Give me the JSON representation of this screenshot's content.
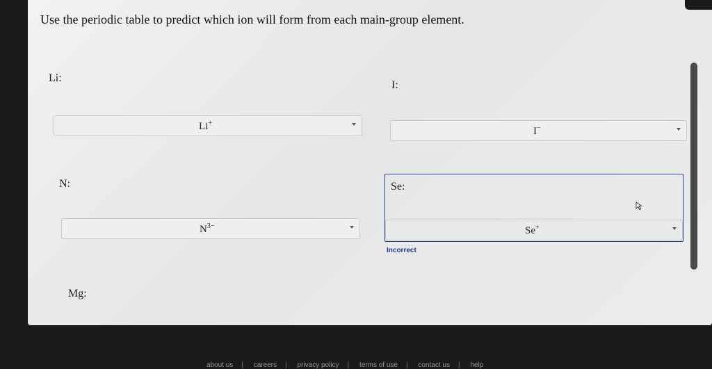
{
  "question": "Use the periodic table to predict which ion will form from each main-group element.",
  "items": [
    {
      "label": "Li:",
      "value_base": "Li",
      "value_charge": "+"
    },
    {
      "label": "I:",
      "value_base": "I",
      "value_charge": "−"
    },
    {
      "label": "N:",
      "value_base": "N",
      "value_charge": "3−"
    },
    {
      "label": "Se:",
      "value_base": "Se",
      "value_charge": "+",
      "feedback": "Incorrect"
    },
    {
      "label": "Mg:"
    }
  ],
  "footer": [
    "about us",
    "careers",
    "privacy policy",
    "terms of use",
    "contact us",
    "help"
  ],
  "colors": {
    "accent": "#1a3f8a",
    "panel": "#ececec",
    "background": "#1a1a1a"
  }
}
